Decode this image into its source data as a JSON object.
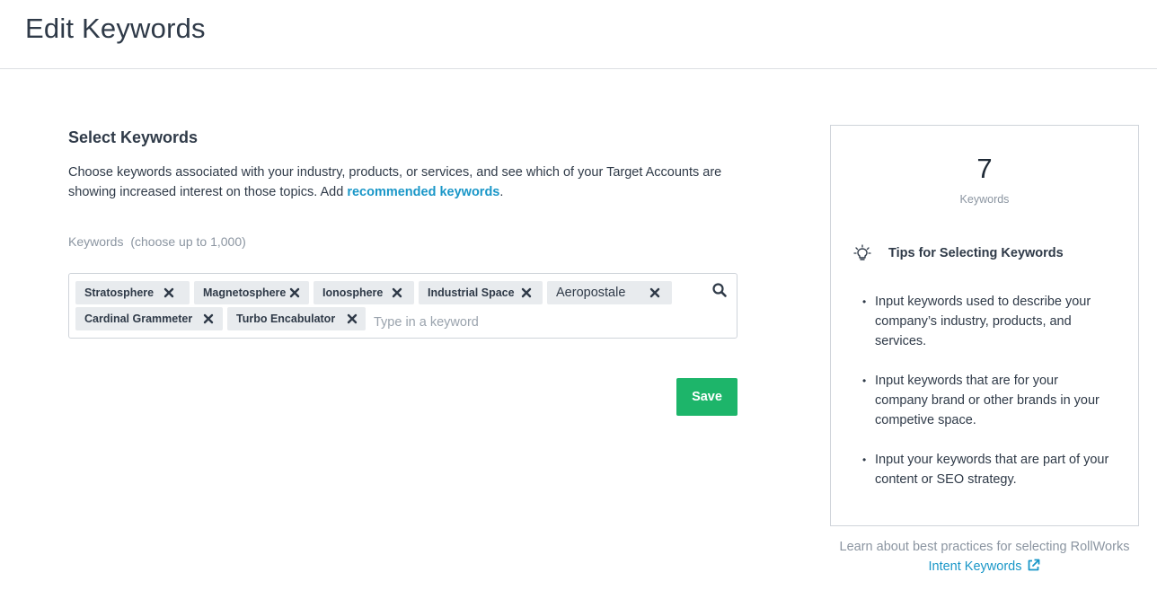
{
  "header": {
    "title": "Edit Keywords"
  },
  "main": {
    "section_title": "Select Keywords",
    "description": "Choose keywords associated with your industry, products, or services, and see which of your Target Accounts are showing increased interest on those topics. Add ",
    "description_link": "recommended keywords",
    "description_end": ".",
    "field_label": "Keywords",
    "field_hint": "(choose up to 1,000)",
    "keywords": [
      "Stratosphere",
      "Magnetosphere",
      "Ionosphere",
      "Industrial Space",
      "Aeropostale",
      "Cardinal Grammeter",
      "Turbo Encabulator"
    ],
    "input_placeholder": "Type in a keyword",
    "save_label": "Save"
  },
  "side_panel": {
    "count": "7",
    "count_label": "Keywords",
    "tips_title": "Tips for Selecting Keywords",
    "tips": [
      "Input keywords used to describe your company’s industry, products, and services.",
      "Input keywords that are for your company brand or other brands in your competive space.",
      "Input your keywords that are part of your content or SEO strategy."
    ]
  },
  "footer": {
    "learn_text": "Learn about best practices for selecting RollWorks",
    "learn_link": "Intent Keywords"
  },
  "icons": {
    "remove": "close-icon",
    "search": "search-icon",
    "tips": "lightbulb-icon",
    "external": "external-link-icon"
  },
  "colors": {
    "accent_link": "#1a97c8",
    "save_button": "#1db56a",
    "tag_background": "#e8ebee"
  }
}
